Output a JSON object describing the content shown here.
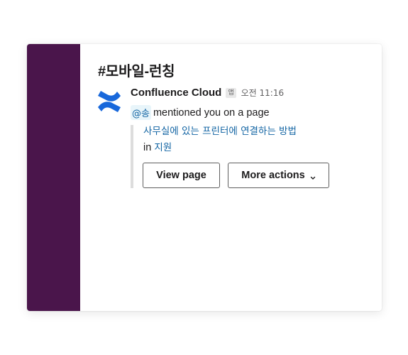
{
  "channel": {
    "title": "#모바일-런칭"
  },
  "message": {
    "sender": "Confluence Cloud",
    "app_badge": "앱",
    "timestamp": "오전 11:16",
    "mention": "@송",
    "text": "mentioned you on a page",
    "avatar_icon": "confluence-logo-icon"
  },
  "attachment": {
    "page_title": "사무실에 있는 프린터에 연결하는 방법",
    "in_label": "in",
    "space_name": "지원"
  },
  "actions": {
    "view_page_label": "View page",
    "more_actions_label": "More actions",
    "more_actions_icon": "chevron-down-icon"
  },
  "colors": {
    "sidebar": "#4a154b",
    "link": "#1264a3",
    "mention_bg": "#e8f5fa",
    "logo": "#1868db"
  }
}
